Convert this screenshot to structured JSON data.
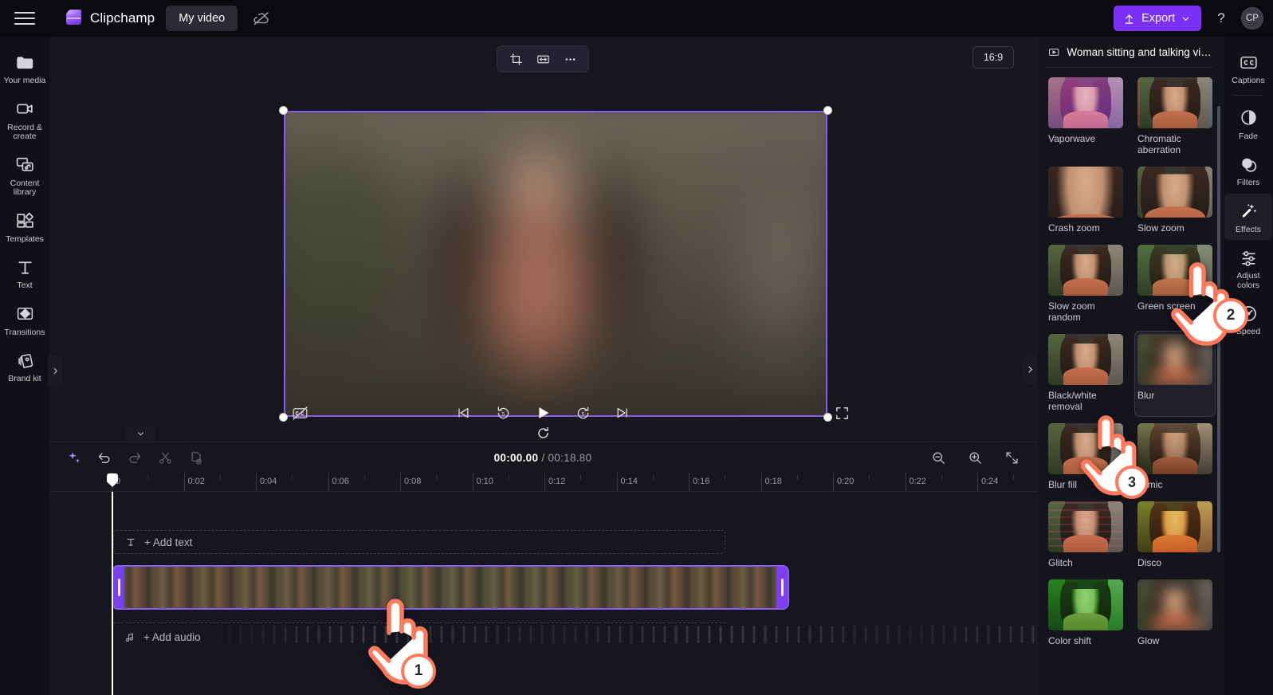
{
  "app": {
    "brand_name": "Clipchamp",
    "project_tab": "My video",
    "cloud_icon": "cloud-off-icon",
    "menu_icon": "hamburger-menu-icon"
  },
  "topbar": {
    "export_label": "Export",
    "export_icon": "upload-icon",
    "export_chevron": "chevron-down-icon",
    "export_color": "#7b2ff7",
    "help_label": "?",
    "avatar_initials": "CP"
  },
  "left_rail": {
    "items": [
      {
        "label": "Your media",
        "icon": "folder-icon"
      },
      {
        "label": "Record & create",
        "icon": "video-camera-icon"
      },
      {
        "label": "Content library",
        "icon": "content-library-icon"
      },
      {
        "label": "Templates",
        "icon": "templates-icon"
      },
      {
        "label": "Text",
        "icon": "text-t-icon"
      },
      {
        "label": "Transitions",
        "icon": "transitions-icon"
      },
      {
        "label": "Brand kit",
        "icon": "brand-kit-icon"
      }
    ],
    "collapse_icon": "chevron-right-icon"
  },
  "preview": {
    "aspect_ratio": "16:9",
    "float_tools": [
      {
        "name": "crop-button",
        "icon": "crop-icon"
      },
      {
        "name": "fit-fill-button",
        "icon": "fit-arrows-icon"
      },
      {
        "name": "more-options-button",
        "icon": "ellipsis-icon"
      }
    ],
    "rotate_icon": "rotate-icon",
    "controls": {
      "captions_toggle_icon": "captions-off-icon",
      "skip_back_icon": "skip-to-start-icon",
      "rewind_icon": "rewind-5-seconds-icon",
      "play_icon": "play-icon",
      "forward_icon": "forward-5-seconds-icon",
      "skip_forward_icon": "skip-to-end-icon",
      "fullscreen_icon": "fullscreen-icon"
    }
  },
  "timeline": {
    "toolbar": [
      {
        "name": "ai-suggestions-button",
        "icon": "sparkle-icon"
      },
      {
        "name": "undo-button",
        "icon": "undo-icon"
      },
      {
        "name": "redo-button",
        "icon": "redo-icon"
      },
      {
        "name": "split-button",
        "icon": "scissors-icon"
      },
      {
        "name": "duplicate-button",
        "icon": "duplicate-icon"
      }
    ],
    "current_time": "00:00.00",
    "separator": "/",
    "total_time": "00:18.80",
    "zoom_controls": [
      {
        "name": "zoom-out-button",
        "icon": "minus-magnifier-icon"
      },
      {
        "name": "zoom-in-button",
        "icon": "plus-magnifier-icon"
      },
      {
        "name": "fit-timeline-button",
        "icon": "fit-to-screen-icon"
      }
    ],
    "ruler_labels": [
      "0",
      "0:02",
      "0:04",
      "0:06",
      "0:08",
      "0:10",
      "0:12",
      "0:14",
      "0:16",
      "0:18",
      "0:20",
      "0:22",
      "0:24"
    ],
    "add_text_label": "+ Add text",
    "add_text_icon": "text-t-icon",
    "add_audio_label": "+ Add audio",
    "add_audio_icon": "music-note-icon",
    "collapse_icon": "chevron-down-icon",
    "clip_selected": true,
    "selection_color": "#8a5cf6"
  },
  "right_panel": {
    "header_title": "Woman sitting and talking video",
    "header_icon": "video-clip-icon",
    "collapse_icon": "chevron-right-icon",
    "selected_effect": "Blur",
    "effects": [
      {
        "label": "Vaporwave",
        "style": "vapor"
      },
      {
        "label": "Chromatic aberration",
        "style": "chroma"
      },
      {
        "label": "Crash zoom",
        "style": "crashzoom"
      },
      {
        "label": "Slow zoom",
        "style": "slowzoom"
      },
      {
        "label": "Slow zoom random",
        "style": "plain"
      },
      {
        "label": "Green screen",
        "style": "green"
      },
      {
        "label": "Black/white removal",
        "style": "plain"
      },
      {
        "label": "Blur",
        "style": "blur"
      },
      {
        "label": "Blur fill",
        "style": "plain"
      },
      {
        "label": "Filmic",
        "style": "filmic"
      },
      {
        "label": "Glitch",
        "style": "glitch"
      },
      {
        "label": "Disco",
        "style": "disco"
      },
      {
        "label": "Color shift",
        "style": "colorshift"
      },
      {
        "label": "Glow",
        "style": "blur"
      }
    ]
  },
  "right_rail": {
    "items": [
      {
        "label": "Captions",
        "icon": "cc-icon",
        "active": false
      },
      {
        "label": "Fade",
        "icon": "fade-icon",
        "active": false
      },
      {
        "label": "Filters",
        "icon": "filters-icon",
        "active": false
      },
      {
        "label": "Effects",
        "icon": "magic-wand-icon",
        "active": true
      },
      {
        "label": "Adjust colors",
        "icon": "adjust-colors-icon",
        "active": false
      },
      {
        "label": "Speed",
        "icon": "speedometer-icon",
        "active": false
      }
    ]
  },
  "annotations": {
    "accent_color": "#ff7a5c",
    "steps": [
      {
        "number": "1",
        "target": "timeline-video-clip"
      },
      {
        "number": "2",
        "target": "right-rail-effects"
      },
      {
        "number": "3",
        "target": "effect-blur"
      }
    ]
  }
}
